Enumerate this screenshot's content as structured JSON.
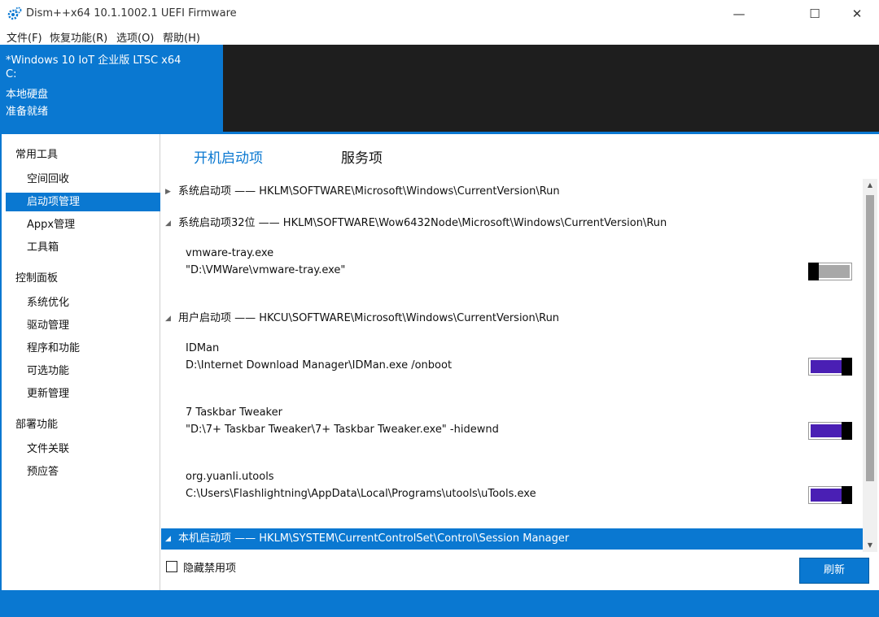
{
  "window": {
    "title": "Dism++x64 10.1.1002.1 UEFI Firmware",
    "minimize": "—",
    "maximize": "☐",
    "close": "✕"
  },
  "menu": [
    "文件(F)",
    "恢复功能(R)",
    "选项(O)",
    "帮助(H)"
  ],
  "header": {
    "os": "*Windows 10 IoT 企业版 LTSC x64",
    "drive": "C:",
    "disk": "本地硬盘",
    "status": "准备就绪"
  },
  "sidebar": {
    "groups": [
      {
        "label": "常用工具",
        "items": [
          "空间回收",
          "启动项管理",
          "Appx管理",
          "工具箱"
        ]
      },
      {
        "label": "控制面板",
        "items": [
          "系统优化",
          "驱动管理",
          "程序和功能",
          "可选功能",
          "更新管理"
        ]
      },
      {
        "label": "部署功能",
        "items": [
          "文件关联",
          "预应答"
        ]
      }
    ],
    "active_item": "启动项管理"
  },
  "tabs": [
    "开机启动项",
    "服务项"
  ],
  "startup": {
    "groups": [
      {
        "label": "系统启动项 —— HKLM\\SOFTWARE\\Microsoft\\Windows\\CurrentVersion\\Run",
        "expanded": false
      },
      {
        "label": "系统启动项32位 —— HKLM\\SOFTWARE\\Wow6432Node\\Microsoft\\Windows\\CurrentVersion\\Run",
        "expanded": true
      },
      {
        "label": "用户启动项 —— HKCU\\SOFTWARE\\Microsoft\\Windows\\CurrentVersion\\Run",
        "expanded": true
      },
      {
        "label": "本机启动项 —— HKLM\\SYSTEM\\CurrentControlSet\\Control\\Session Manager",
        "expanded": true,
        "selected": true
      }
    ],
    "entries": [
      {
        "name": "vmware-tray.exe",
        "path": "\"D:\\VMWare\\vmware-tray.exe\"",
        "enabled": false
      },
      {
        "name": "IDMan",
        "path": "D:\\Internet Download Manager\\IDMan.exe /onboot",
        "enabled": true
      },
      {
        "name": "7 Taskbar Tweaker",
        "path": "\"D:\\7+ Taskbar Tweaker\\7+ Taskbar Tweaker.exe\" -hidewnd",
        "enabled": true
      },
      {
        "name": "org.yuanli.utools",
        "path": "C:\\Users\\Flashlightning\\AppData\\Local\\Programs\\utools\\uTools.exe",
        "enabled": true
      }
    ]
  },
  "footer": {
    "hide_disabled_label": "隐藏禁用项",
    "refresh_label": "刷新"
  },
  "colors": {
    "accent": "#0a78d1",
    "toggle_on": "#4a1fb4",
    "header_dark": "#1e1e1e"
  }
}
